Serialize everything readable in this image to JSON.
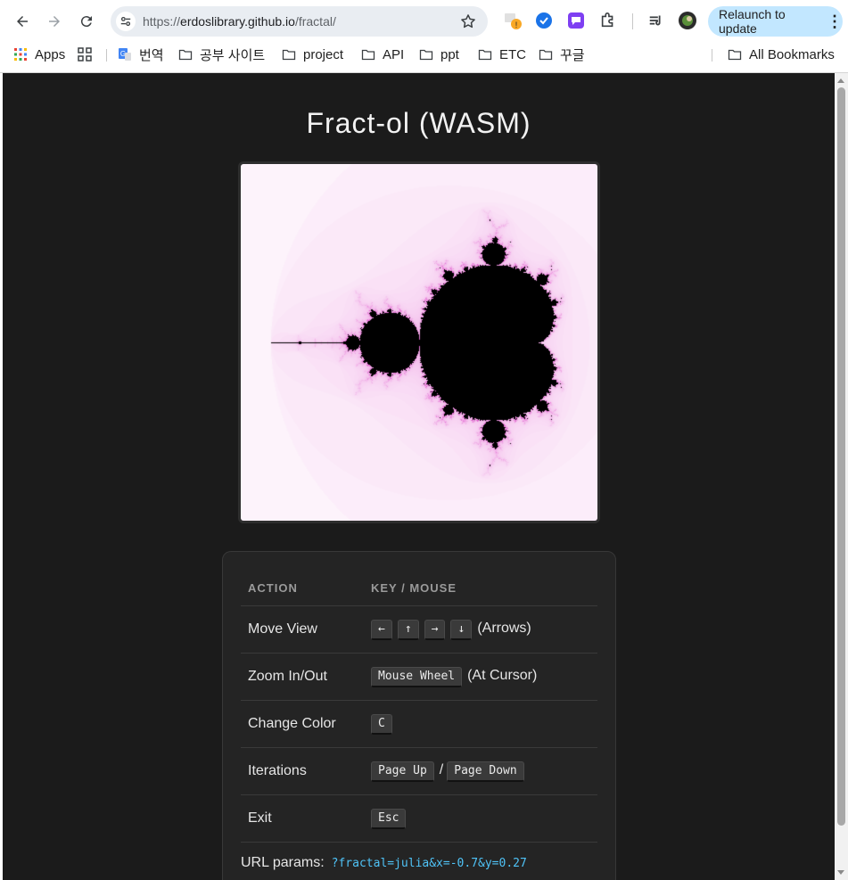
{
  "browser": {
    "url_prefix": "https://",
    "url_host": "erdoslibrary.github.io",
    "url_path": "/fractal/",
    "relaunch_label": "Relaunch to update",
    "bookmarks": [
      "Apps",
      "번역",
      "공부 사이트",
      "project",
      "API",
      "ppt",
      "ETC",
      "꾸글"
    ],
    "all_bookmarks": "All Bookmarks"
  },
  "page": {
    "title": "Fract-ol (WASM)",
    "controls": {
      "header_action": "ACTION",
      "header_key": "KEY / MOUSE",
      "rows": [
        {
          "action": "Move View",
          "keys": [
            "←",
            "↑",
            "→",
            "↓"
          ],
          "note": "(Arrows)"
        },
        {
          "action": "Zoom In/Out",
          "keys": [
            "Mouse Wheel"
          ],
          "note": "(At Cursor)"
        },
        {
          "action": "Change Color",
          "keys": [
            "C"
          ],
          "note": ""
        },
        {
          "action": "Iterations",
          "keys": [
            "Page Up",
            "Page Down"
          ],
          "separator": "/"
        },
        {
          "action": "Exit",
          "keys": [
            "Esc"
          ],
          "note": ""
        }
      ]
    },
    "url_params_label": "URL params:",
    "url_params_example": "?fractal=julia&x=-0.7&y=0.27"
  },
  "colors": {
    "page_bg": "#1b1b1b",
    "panel_bg": "#242424",
    "code_accent": "#4fc3f7",
    "relaunch_bg": "#c2e7ff"
  },
  "fractal": {
    "type": "mandelbrot",
    "palette": [
      "#ffffff",
      "#ffe4f0",
      "#e26ad0"
    ]
  }
}
